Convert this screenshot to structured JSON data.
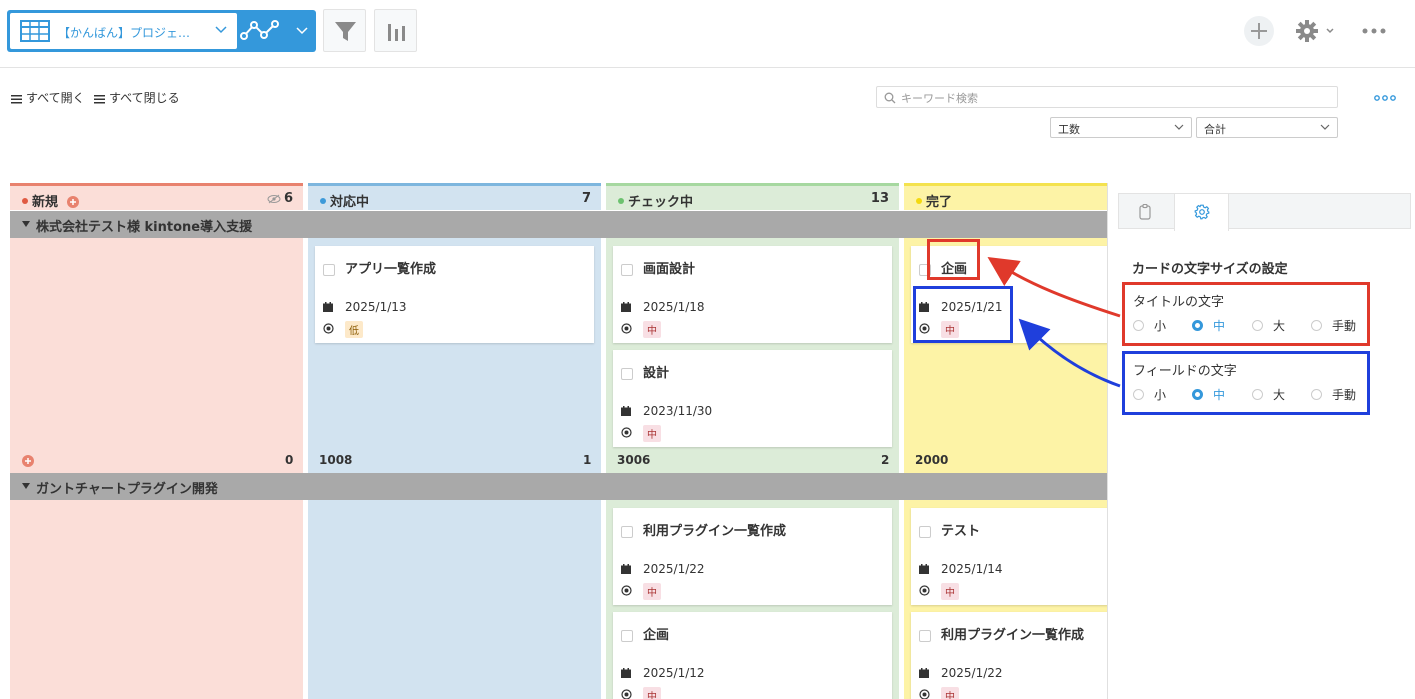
{
  "toolbar": {
    "view_label": "【かんばん】プロジェ…",
    "plus_label": "+"
  },
  "subbar": {
    "expand_all": "すべて開く",
    "collapse_all": "すべて閉じる",
    "search_placeholder": "キーワード検索",
    "dropdown_field": "工数",
    "dropdown_agg": "合計"
  },
  "columns": [
    {
      "name": "新規",
      "count": "6",
      "color": "#e8826e"
    },
    {
      "name": "対応中",
      "count": "7",
      "color": "#3d9ad9"
    },
    {
      "name": "チェック中",
      "count": "13",
      "color": "#6cc26f"
    },
    {
      "name": "完了",
      "count": "",
      "color": "#f4d90e"
    }
  ],
  "lanes": [
    {
      "name": "株式会社テスト様 kintone導入支援",
      "footers": [
        {
          "sum": "",
          "count": "0"
        },
        {
          "sum": "1008",
          "count": "1"
        },
        {
          "sum": "3006",
          "count": "2"
        },
        {
          "sum": "2000",
          "count": ""
        }
      ]
    },
    {
      "name": "ガントチャートプラグイン開発"
    }
  ],
  "cards": [
    {
      "title": "アプリ一覧作成",
      "date": "2025/1/13",
      "priority": "低"
    },
    {
      "title": "画面設計",
      "date": "2025/1/18",
      "priority": "中"
    },
    {
      "title": "設計",
      "date": "2023/11/30",
      "priority": "中"
    },
    {
      "title": "企画",
      "date": "2025/1/21",
      "priority": "中"
    },
    {
      "title": "利用プラグイン一覧作成",
      "date": "2025/1/22",
      "priority": "中"
    },
    {
      "title": "企画",
      "date": "2025/1/12",
      "priority": "中"
    },
    {
      "title": "テスト",
      "date": "2025/1/14",
      "priority": "中"
    },
    {
      "title": "利用プラグイン一覧作成",
      "date": "2025/1/22",
      "priority": "中"
    }
  ],
  "settings": {
    "title": "カードの文字サイズの設定",
    "title_group": {
      "label": "タイトルの文字",
      "options": [
        "小",
        "中",
        "大",
        "手動"
      ],
      "selected": "中"
    },
    "field_group": {
      "label": "フィールドの文字",
      "options": [
        "小",
        "中",
        "大",
        "手動"
      ],
      "selected": "中"
    }
  },
  "colors": {
    "accent": "#3498db",
    "highlight_red": "#e0392b",
    "highlight_blue": "#1f3fdc"
  }
}
